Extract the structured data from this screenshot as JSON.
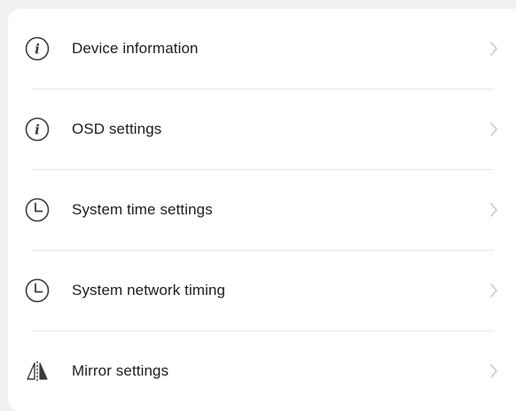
{
  "menu": {
    "items": [
      {
        "label": "Device information",
        "icon": "info-icon"
      },
      {
        "label": "OSD settings",
        "icon": "info-icon"
      },
      {
        "label": "System time settings",
        "icon": "clock-icon"
      },
      {
        "label": "System network timing",
        "icon": "clock-icon"
      },
      {
        "label": "Mirror settings",
        "icon": "mirror-icon"
      }
    ]
  },
  "colors": {
    "background": "#f1f1f3",
    "card": "#ffffff",
    "text": "#1d1d1f",
    "icon": "#3a3a3c",
    "chevron": "#c7c7cc",
    "divider": "#e6e6ea"
  }
}
